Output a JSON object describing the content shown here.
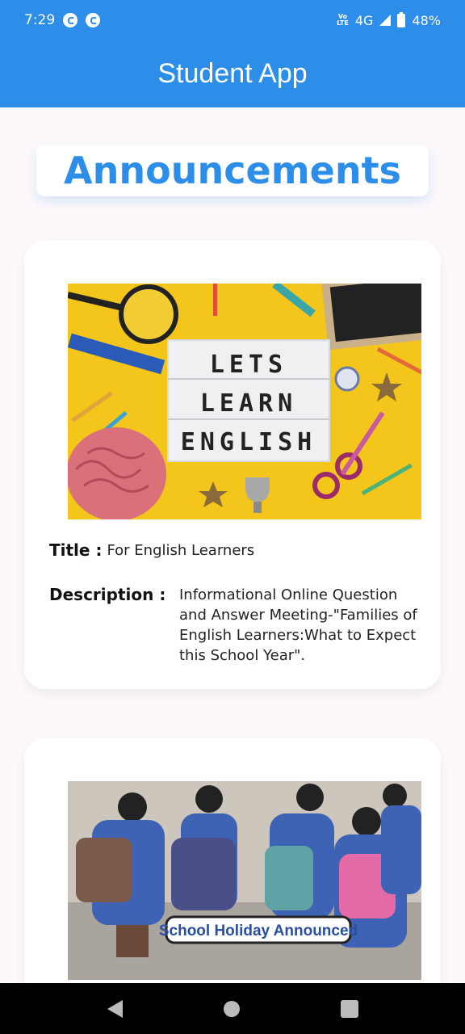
{
  "status_bar": {
    "time": "7:29",
    "volte": "VoLTE",
    "network": "4G",
    "battery": "48%"
  },
  "app_bar": {
    "title": "Student App"
  },
  "page": {
    "heading": "Announcements"
  },
  "announcements": [
    {
      "image_text_lines": [
        "LETS",
        "LEARN",
        "ENGLISH"
      ],
      "title_label": "Title :",
      "title": "For English Learners",
      "description_label": "Description :",
      "description": "Informational Online Question and Answer Meeting-\"Families of English Learners:What to Expect this School Year\"."
    },
    {
      "image_banner": "School Holiday Announced"
    }
  ],
  "colors": {
    "primary": "#2d8ee9",
    "background": "#fdf8fb",
    "card": "#ffffff"
  }
}
